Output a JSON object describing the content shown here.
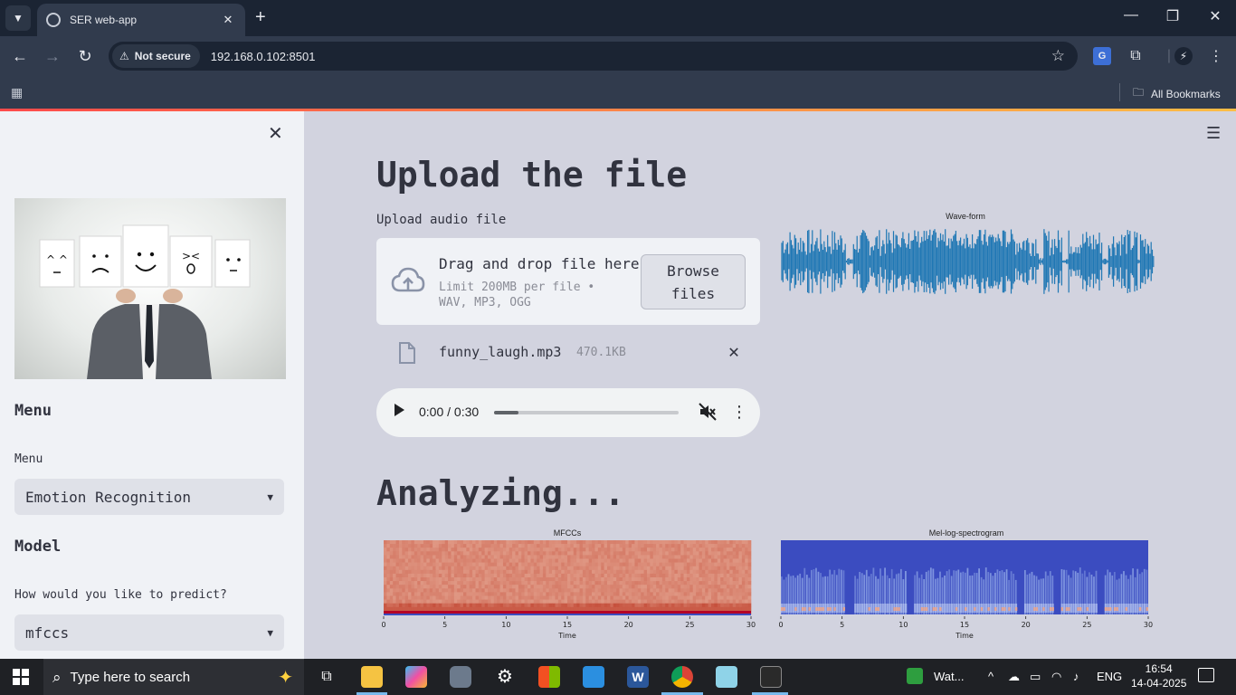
{
  "browser": {
    "tab_title": "SER web-app",
    "new_tab": "+",
    "security_label": "Not secure",
    "url": "192.168.0.102:8501",
    "all_bookmarks": "All Bookmarks"
  },
  "sidebar": {
    "menu_heading": "Menu",
    "menu_label": "Menu",
    "menu_value": "Emotion Recognition",
    "model_heading": "Model",
    "predict_label": "How would you like to predict?",
    "predict_value": "mfccs"
  },
  "main": {
    "title": "Upload the file",
    "upload_label": "Upload audio file",
    "dropzone": {
      "title": "Drag and drop file here",
      "subtitle": "Limit 200MB per file • WAV, MP3, OGG",
      "browse_line1": "Browse",
      "browse_line2": "files"
    },
    "file": {
      "name": "funny_laugh.mp3",
      "size": "470.1KB"
    },
    "audio": {
      "time": "0:00 / 0:30",
      "progress": 0.13
    },
    "analyzing": "Analyzing..."
  },
  "plots": {
    "waveform_title": "Wave-form",
    "mfcc_title": "MFCCs",
    "mel_title": "Mel-log-spectrogram",
    "x_label": "Time",
    "x_ticks": [
      "0",
      "5",
      "10",
      "15",
      "20",
      "25",
      "30"
    ]
  },
  "colors": {
    "waveform": "#1f77b4",
    "accent": "#ff4b4b",
    "mfcc_low": "#e9c3a9",
    "mfcc_high": "#f3876a",
    "mel_bg": "#3b4cc0"
  },
  "taskbar": {
    "search_placeholder": "Type here to search",
    "app_label": "Wat...",
    "language": "ENG",
    "time": "16:54",
    "date": "14-04-2025"
  }
}
